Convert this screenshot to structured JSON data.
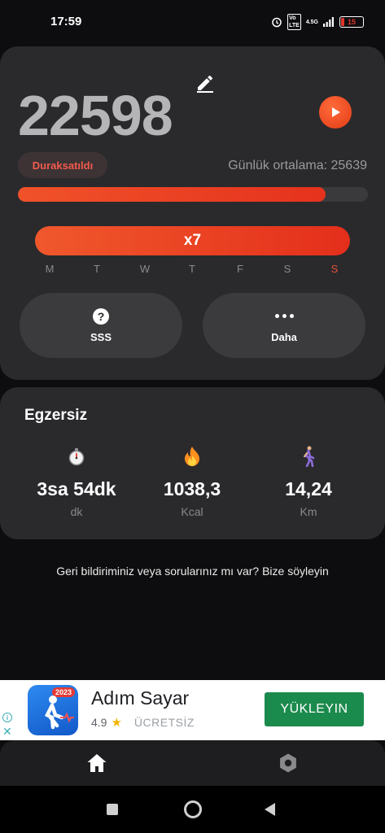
{
  "status_bar": {
    "time": "17:59",
    "battery": "15",
    "network": "4.5G",
    "volte": "Vo LTE"
  },
  "steps": {
    "count": "22598",
    "paused_label": "Duraksatıldı",
    "daily_average": "Günlük ortalama: 25639",
    "progress_fraction": 0.88
  },
  "streak": {
    "label": "x7",
    "weekdays": [
      "M",
      "T",
      "W",
      "T",
      "F",
      "S",
      "S"
    ],
    "today_index": 6
  },
  "actions": {
    "faq_label": "SSS",
    "more_label": "Daha"
  },
  "exercise": {
    "title": "Egzersiz",
    "stats": [
      {
        "icon": "stopwatch-icon",
        "value": "3sa 54dk",
        "unit": "dk"
      },
      {
        "icon": "fire-icon",
        "value": "1038,3",
        "unit": "Kcal"
      },
      {
        "icon": "walking-person-icon",
        "value": "14,24",
        "unit": "Km"
      }
    ]
  },
  "feedback_text": "Geri bildiriminiz veya sorularınız mı var? Bize söyleyin",
  "ad": {
    "title": "Adım Sayar",
    "rating": "4.9",
    "price": "ÜCRETSİZ",
    "install_label": "YÜKLEYIN",
    "year_badge": "2023"
  },
  "colors": {
    "accent": "#e8402a",
    "card": "#2a2a2d",
    "background": "#0d0d0f",
    "install": "#1b8a4d"
  }
}
